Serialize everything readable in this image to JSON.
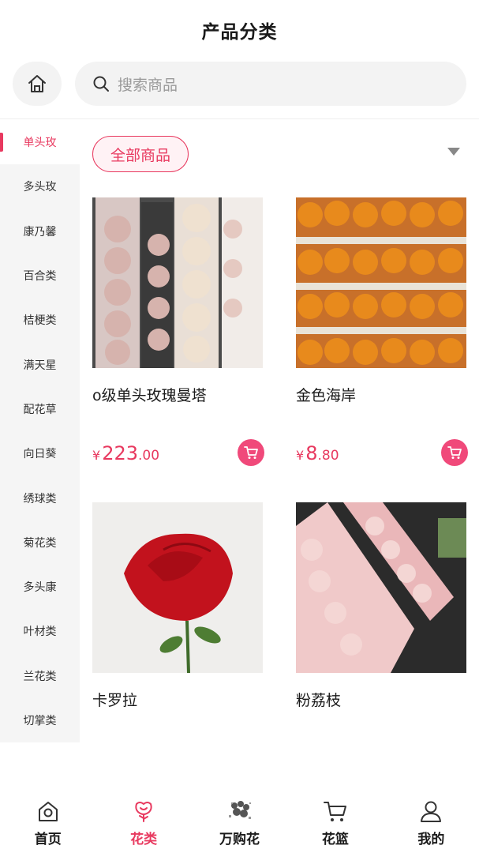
{
  "header": {
    "title": "产品分类"
  },
  "search": {
    "placeholder": "搜索商品"
  },
  "sidebar": {
    "items": [
      {
        "label": "单头玫",
        "active": true
      },
      {
        "label": "多头玫"
      },
      {
        "label": "康乃馨"
      },
      {
        "label": "百合类"
      },
      {
        "label": "桔梗类"
      },
      {
        "label": "满天星"
      },
      {
        "label": "配花草"
      },
      {
        "label": "向日葵"
      },
      {
        "label": "绣球类"
      },
      {
        "label": "菊花类"
      },
      {
        "label": "多头康"
      },
      {
        "label": "叶材类"
      },
      {
        "label": "兰花类"
      },
      {
        "label": "切掌类"
      }
    ]
  },
  "filter": {
    "label": "全部商品"
  },
  "products": [
    {
      "name": "o级单头玫瑰曼塔",
      "currency": "¥",
      "price_int": "223",
      "price_dec": ".00"
    },
    {
      "name": "金色海岸",
      "currency": "¥",
      "price_int": "8",
      "price_dec": ".80"
    },
    {
      "name": "卡罗拉"
    },
    {
      "name": "粉荔枝"
    }
  ],
  "tabbar": {
    "tabs": [
      {
        "label": "首页",
        "icon": "home-icon"
      },
      {
        "label": "花类",
        "icon": "flower-icon",
        "active": true
      },
      {
        "label": "万购花",
        "icon": "bouquet-icon"
      },
      {
        "label": "花篮",
        "icon": "basket-icon"
      },
      {
        "label": "我的",
        "icon": "user-icon"
      }
    ]
  },
  "colors": {
    "accent": "#e8395f",
    "cart_button": "#f0497a",
    "sidebar_bg": "#f5f5f5"
  }
}
